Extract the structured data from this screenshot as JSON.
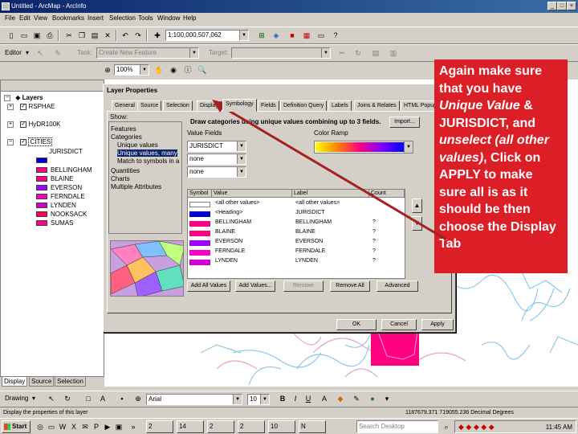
{
  "window": {
    "title": "Untitled - ArcMap - ArcInfo"
  },
  "menu": [
    "File",
    "Edit",
    "View",
    "Bookmarks",
    "Insert",
    "Selection",
    "Tools",
    "Window",
    "Help"
  ],
  "toolbar1": {
    "scale": "1:100,000,507,062"
  },
  "toolbar2": {
    "editor_label": "Editor",
    "task_label": "Task:",
    "task_value": "Create New Feature",
    "target_label": "Target:",
    "zoom_value": "100%"
  },
  "toc": {
    "root": "Layers",
    "layers": [
      "RSPHAE",
      "HyDR100K",
      "CITIES"
    ],
    "field": "JURISDICT",
    "legend": [
      {
        "label": "BELLINGHAM",
        "color": "#ff0080"
      },
      {
        "label": "BLAINE",
        "color": "#ff0080"
      },
      {
        "label": "EVERSON",
        "color": "#a000ff"
      },
      {
        "label": "FERNDALE",
        "color": "#ff00c0"
      },
      {
        "label": "LYNDEN",
        "color": "#d000d0"
      },
      {
        "label": "NOOKSACK",
        "color": "#ff0060"
      },
      {
        "label": "SUMAS",
        "color": "#ff0090"
      }
    ],
    "tabs": [
      "Display",
      "Source",
      "Selection"
    ],
    "legend_blue": "#0000cc"
  },
  "dialog": {
    "title": "Layer Properties",
    "tabs": [
      "General",
      "Source",
      "Selection",
      "Display",
      "Symbology",
      "Fields",
      "Definition Query",
      "Labels",
      "Joins & Relates",
      "HTML Popup"
    ],
    "show_label": "Show:",
    "show_items": [
      "Features",
      "Categories",
      "Unique values",
      "Unique values, many",
      "Match to symbols in a",
      "Quantities",
      "Charts",
      "Multiple Attributes"
    ],
    "draw_label": "Draw categories using unique values combining up to 3 fields.",
    "import_btn": "Import...",
    "value_fields_label": "Value Fields",
    "value_fields": [
      "JURISDICT",
      "none",
      "none"
    ],
    "color_ramp_label": "Color Ramp",
    "grid_headers": [
      "Symbol",
      "Value",
      "Label",
      "Count"
    ],
    "grid_rows": [
      {
        "value": "<all other values>",
        "label": "<all other values>",
        "count": "",
        "color": "#ffffff"
      },
      {
        "value": "<Heading>",
        "label": "JURISDICT",
        "count": "",
        "color": "#0000cc"
      },
      {
        "value": "BELLINGHAM",
        "label": "BELLINGHAM",
        "count": "?",
        "color": "#ff0080"
      },
      {
        "value": "BLAINE",
        "label": "BLAINE",
        "count": "?",
        "color": "#ff0080"
      },
      {
        "value": "EVERSON",
        "label": "EVERSON",
        "count": "?",
        "color": "#a000ff"
      },
      {
        "value": "FERNDALE",
        "label": "FERNDALE",
        "count": "?",
        "color": "#ff00c0"
      },
      {
        "value": "LYNDEN",
        "label": "LYNDEN",
        "count": "?",
        "color": "#d000d0"
      }
    ],
    "buttons": {
      "add_all": "Add All Values",
      "add_values": "Add Values...",
      "remove": "Remove",
      "remove_all": "Remove All",
      "advanced": "Advanced",
      "ok": "OK",
      "cancel": "Cancel",
      "apply": "Apply"
    }
  },
  "callout": {
    "line1": "Again make sure that you have ",
    "em1": "Unique Value",
    "line2": "  & JURISDICT,  and ",
    "em2": "unselect (all other values)",
    "line3": ", Click on APPLY to make sure all is as it should be then choose the Display Tab"
  },
  "drawbar": {
    "drawing_label": "Drawing",
    "font": "Arial",
    "size": "10"
  },
  "statusbar": {
    "left": "Display the properties of this layer",
    "right": "1187679.371  719055.236 Decimal Degrees"
  },
  "taskbar": {
    "start": "Start",
    "tasks": [
      "2",
      "14",
      "2",
      "2",
      "10",
      "N"
    ],
    "search": "Search Desktop",
    "clock": "11:45 AM"
  }
}
